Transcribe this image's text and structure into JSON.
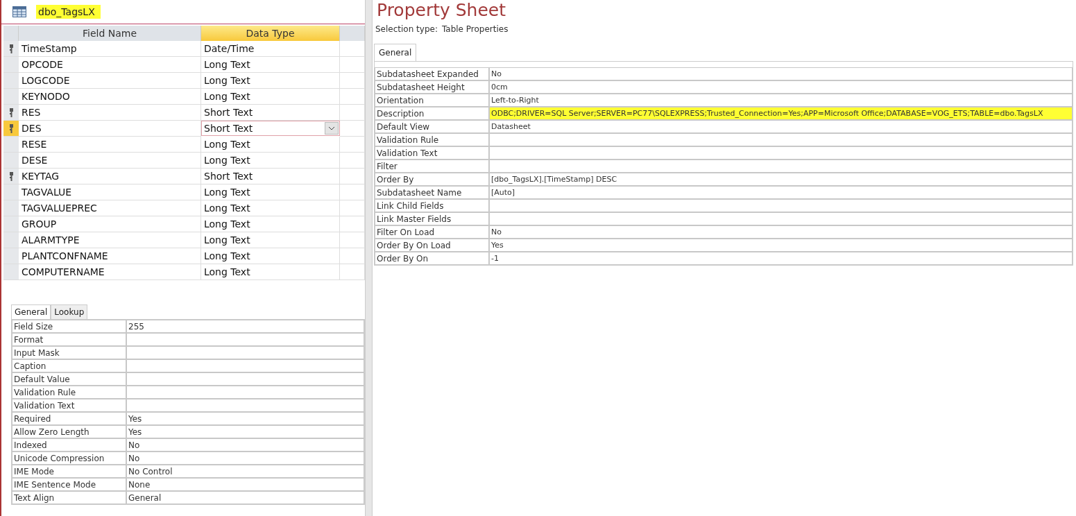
{
  "table_design": {
    "title": "dbo_TagsLX",
    "title_highlighted": true,
    "columns": [
      {
        "label": "Field Name",
        "selected": false
      },
      {
        "label": "Data Type",
        "selected": true
      }
    ],
    "rows": [
      {
        "field_name": "TimeStamp",
        "data_type": "Date/Time",
        "primary_key": true,
        "selected": false
      },
      {
        "field_name": "OPCODE",
        "data_type": "Long Text",
        "primary_key": false,
        "selected": false
      },
      {
        "field_name": "LOGCODE",
        "data_type": "Long Text",
        "primary_key": false,
        "selected": false
      },
      {
        "field_name": "KEYNODO",
        "data_type": "Long Text",
        "primary_key": false,
        "selected": false
      },
      {
        "field_name": "RES",
        "data_type": "Short Text",
        "primary_key": true,
        "selected": false
      },
      {
        "field_name": "DES",
        "data_type": "Short Text",
        "primary_key": true,
        "selected": true
      },
      {
        "field_name": "RESE",
        "data_type": "Long Text",
        "primary_key": false,
        "selected": false
      },
      {
        "field_name": "DESE",
        "data_type": "Long Text",
        "primary_key": false,
        "selected": false
      },
      {
        "field_name": "KEYTAG",
        "data_type": "Short Text",
        "primary_key": true,
        "selected": false
      },
      {
        "field_name": "TAGVALUE",
        "data_type": "Long Text",
        "primary_key": false,
        "selected": false
      },
      {
        "field_name": "TAGVALUEPREC",
        "data_type": "Long Text",
        "primary_key": false,
        "selected": false
      },
      {
        "field_name": "GROUP",
        "data_type": "Long Text",
        "primary_key": false,
        "selected": false
      },
      {
        "field_name": "ALARMTYPE",
        "data_type": "Long Text",
        "primary_key": false,
        "selected": false
      },
      {
        "field_name": "PLANTCONFNAME",
        "data_type": "Long Text",
        "primary_key": false,
        "selected": false
      },
      {
        "field_name": "COMPUTERNAME",
        "data_type": "Long Text",
        "primary_key": false,
        "selected": false
      }
    ]
  },
  "field_properties": {
    "tabs": [
      {
        "label": "General",
        "selected": true
      },
      {
        "label": "Lookup",
        "selected": false
      }
    ],
    "rows": [
      {
        "name": "Field Size",
        "value": "255"
      },
      {
        "name": "Format"
      },
      {
        "name": "Input Mask"
      },
      {
        "name": "Caption"
      },
      {
        "name": "Default Value"
      },
      {
        "name": "Validation Rule"
      },
      {
        "name": "Validation Text"
      },
      {
        "name": "Required",
        "value": "Yes"
      },
      {
        "name": "Allow Zero Length",
        "value": "Yes"
      },
      {
        "name": "Indexed",
        "value": "No"
      },
      {
        "name": "Unicode Compression",
        "value": "No"
      },
      {
        "name": "IME Mode",
        "value": "No Control"
      },
      {
        "name": "IME Sentence Mode",
        "value": "None"
      },
      {
        "name": "Text Align",
        "value": "General"
      }
    ]
  },
  "property_sheet": {
    "title": "Property Sheet",
    "selection_type_label": "Selection type:",
    "selection_type": "Table Properties",
    "tabs": [
      {
        "label": "General",
        "selected": true
      }
    ],
    "rows": [
      {
        "name": "Subdatasheet Expanded",
        "value": "No",
        "highlighted": false
      },
      {
        "name": "Subdatasheet Height",
        "value": "0cm",
        "highlighted": false
      },
      {
        "name": "Orientation",
        "value": "Left-to-Right",
        "highlighted": false
      },
      {
        "name": "Description",
        "value": "ODBC;DRIVER=SQL Server;SERVER=PC77\\SQLEXPRESS;Trusted_Connection=Yes;APP=Microsoft Office;DATABASE=VOG_ETS;TABLE=dbo.TagsLX",
        "highlighted": true
      },
      {
        "name": "Default View",
        "value": "Datasheet",
        "highlighted": false
      },
      {
        "name": "Validation Rule",
        "highlighted": false
      },
      {
        "name": "Validation Text",
        "highlighted": false
      },
      {
        "name": "Filter",
        "highlighted": false
      },
      {
        "name": "Order By",
        "value": "[dbo_TagsLX].[TimeStamp] DESC",
        "highlighted": false
      },
      {
        "name": "Subdatasheet Name",
        "value": "[Auto]",
        "highlighted": false
      },
      {
        "name": "Link Child Fields",
        "highlighted": false
      },
      {
        "name": "Link Master Fields",
        "highlighted": false
      },
      {
        "name": "Filter On Load",
        "value": "No",
        "highlighted": false
      },
      {
        "name": "Order By On Load",
        "value": "Yes",
        "highlighted": false
      },
      {
        "name": "Order By On",
        "value": "-1",
        "highlighted": false
      }
    ]
  }
}
